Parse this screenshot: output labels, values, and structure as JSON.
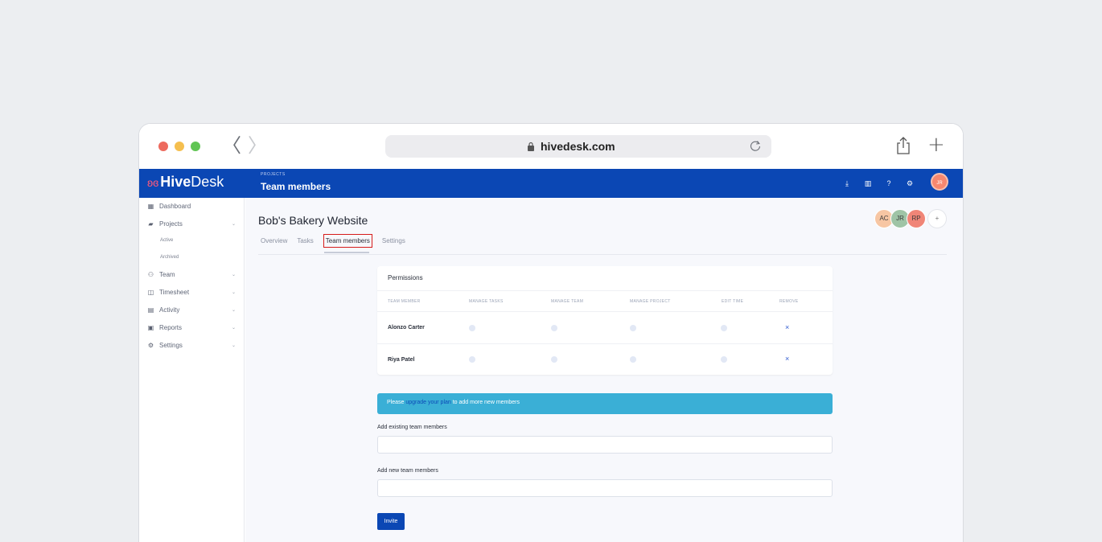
{
  "browser": {
    "url": "hivedesk.com",
    "back_glyph": "〈",
    "forward_glyph": "〉",
    "new_tab_glyph": "+"
  },
  "app": {
    "brand_hive": "Hive",
    "brand_desk": "Desk",
    "brand_mark": "ʚɞ",
    "breadcrumb_small": "PROJECTS",
    "breadcrumb_title": "Team members",
    "top_icons": [
      "download-icon",
      "book-icon",
      "help-icon",
      "settings-icon"
    ],
    "user_initials": "JR",
    "accent_color": "#0b47b4"
  },
  "sidebar": {
    "items": [
      {
        "label": "Dashboard",
        "icon": "dashboard-icon",
        "glyph": "▦"
      },
      {
        "label": "Projects",
        "icon": "folder-icon",
        "glyph": "▰",
        "chev": "⌄"
      },
      {
        "label": "Team",
        "icon": "team-icon",
        "glyph": "⚇",
        "chev": "⌄"
      },
      {
        "label": "Timesheet",
        "icon": "timesheet-icon",
        "glyph": "◫",
        "chev": "⌄"
      },
      {
        "label": "Activity",
        "icon": "activity-icon",
        "glyph": "▤",
        "chev": "⌄"
      },
      {
        "label": "Reports",
        "icon": "reports-icon",
        "glyph": "▣",
        "chev": "⌄"
      },
      {
        "label": "Settings",
        "icon": "settings-icon",
        "glyph": "⚙",
        "chev": "⌄"
      }
    ],
    "project_sub": [
      "Active",
      "Archived"
    ]
  },
  "main": {
    "project_title": "Bob's Bakery Website",
    "avatars": [
      {
        "initials": "AC",
        "color": "#f7c6a3"
      },
      {
        "initials": "JR",
        "color": "#9fc4a6"
      },
      {
        "initials": "RP",
        "color": "#f08577"
      }
    ],
    "add_member_glyph": "+",
    "tabs": [
      "Overview",
      "Tasks",
      "Team members",
      "Settings"
    ],
    "active_tab": "Team members"
  },
  "permissions": {
    "title": "Permissions",
    "columns": [
      "TEAM MEMBER",
      "MANAGE TASKS",
      "MANAGE TEAM",
      "MANAGE PROJECT",
      "EDIT TIME",
      "REMOVE"
    ],
    "rows": [
      {
        "name": "Alonzo Carter",
        "remove": "×"
      },
      {
        "name": "Riya Patel",
        "remove": "×"
      }
    ]
  },
  "upgrade": {
    "before": "Please ",
    "link": "upgrade your plan",
    "after": " to add more new members"
  },
  "form": {
    "existing_label": "Add existing team members",
    "existing_value": "",
    "new_label": "Add new team members",
    "new_value": "",
    "invite_label": "Invite"
  }
}
